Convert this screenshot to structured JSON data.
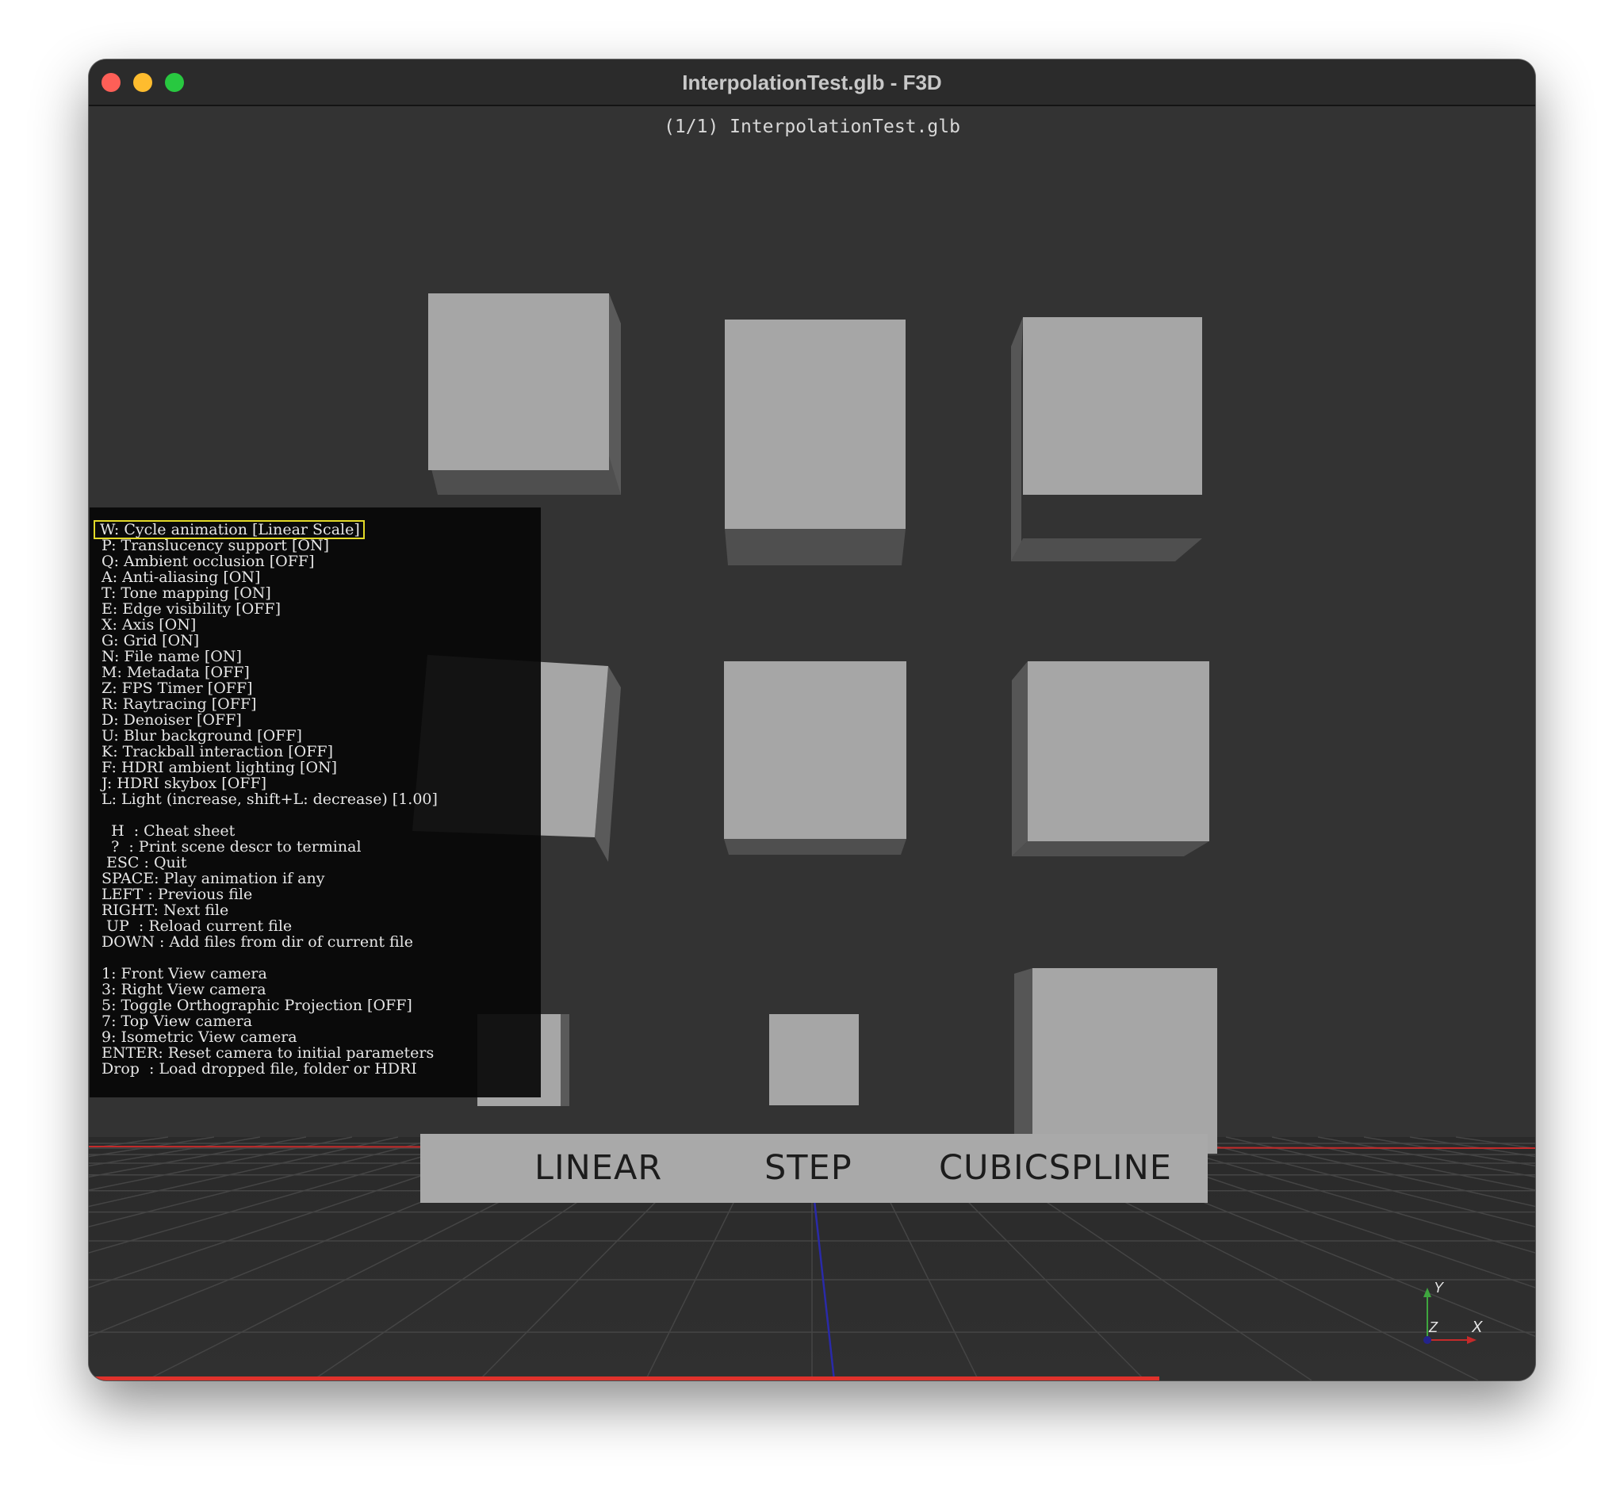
{
  "window": {
    "title": "InterpolationTest.glb - F3D"
  },
  "viewport": {
    "file_label": "(1/1) InterpolationTest.glb",
    "animation_labels": [
      "LINEAR",
      "STEP",
      "CUBICSPLINE"
    ],
    "animation_progress": 0.74,
    "axes": {
      "y": "Y",
      "z": "Z",
      "x": "X"
    },
    "colors": {
      "background": "#333333",
      "cube_face": "#a6a6a6",
      "cube_side": "#555555",
      "grid_x": "#c42a2a",
      "grid_z": "#2a2aa8",
      "progress": "#e0322c"
    }
  },
  "cheatsheet": {
    "highlight_index": 0,
    "options": [
      "W: Cycle animation [Linear Scale]",
      "P: Translucency support [ON]",
      "Q: Ambient occlusion [OFF]",
      "A: Anti-aliasing [ON]",
      "T: Tone mapping [ON]",
      "E: Edge visibility [OFF]",
      "X: Axis [ON]",
      "G: Grid [ON]",
      "N: File name [ON]",
      "M: Metadata [OFF]",
      "Z: FPS Timer [OFF]",
      "R: Raytracing [OFF]",
      "D: Denoiser [OFF]",
      "U: Blur background [OFF]",
      "K: Trackball interaction [OFF]",
      "F: HDRI ambient lighting [ON]",
      "J: HDRI skybox [OFF]",
      "L: Light (increase, shift+L: decrease) [1.00]"
    ],
    "keys": [
      "  H  : Cheat sheet",
      "  ?  : Print scene descr to terminal",
      " ESC : Quit",
      "SPACE: Play animation if any",
      "LEFT : Previous file",
      "RIGHT: Next file",
      " UP  : Reload current file",
      "DOWN : Add files from dir of current file"
    ],
    "cameras": [
      "1: Front View camera",
      "3: Right View camera",
      "5: Toggle Orthographic Projection [OFF]",
      "7: Top View camera",
      "9: Isometric View camera",
      "ENTER: Reset camera to initial parameters",
      "Drop  : Load dropped file, folder or HDRI"
    ]
  }
}
